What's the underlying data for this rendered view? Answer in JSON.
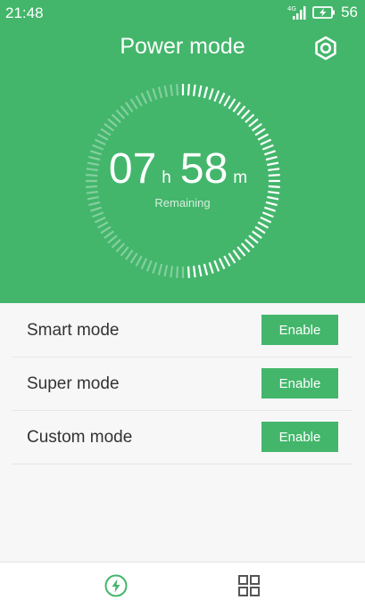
{
  "status_bar": {
    "time": "21:48",
    "network": "4G",
    "battery_level": "56",
    "battery_charging": true,
    "icons": [
      "signal-icon",
      "battery-charging-icon"
    ]
  },
  "header": {
    "title": "Power mode",
    "settings_icon": "gear-icon"
  },
  "timer": {
    "hours": "07",
    "hours_unit": "h",
    "minutes": "58",
    "minutes_unit": "m",
    "caption": "Remaining",
    "charge_fraction": 0.5
  },
  "modes": [
    {
      "label": "Smart mode",
      "button": "Enable"
    },
    {
      "label": "Super mode",
      "button": "Enable"
    },
    {
      "label": "Custom mode",
      "button": "Enable"
    }
  ],
  "bottom_nav": {
    "items": [
      {
        "icon": "lightning-bolt-icon",
        "active": true
      },
      {
        "icon": "grid-icon",
        "active": false
      }
    ]
  },
  "colors": {
    "accent": "#43b66b",
    "background": "#f7f7f7",
    "text": "#333333"
  }
}
